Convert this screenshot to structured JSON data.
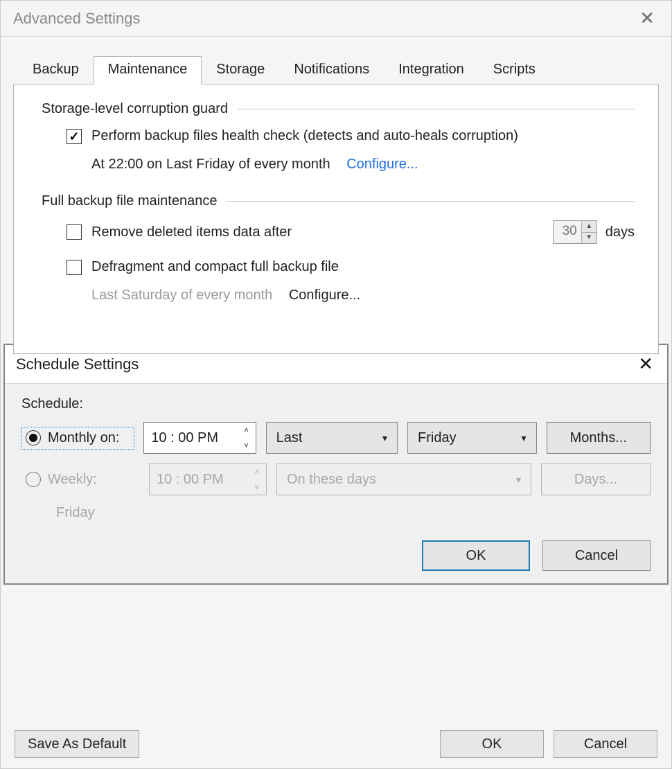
{
  "window": {
    "title": "Advanced Settings",
    "close_icon": "✕"
  },
  "tabs": {
    "backup": "Backup",
    "maintenance": "Maintenance",
    "storage": "Storage",
    "notifications": "Notifications",
    "integration": "Integration",
    "scripts": "Scripts"
  },
  "groups": {
    "corruption_guard": {
      "title": "Storage-level corruption guard",
      "health_check_label": "Perform backup files health check (detects and auto-heals corruption)",
      "health_check_checked": true,
      "schedule_text": "At 22:00 on Last Friday of every month",
      "configure": "Configure..."
    },
    "fb_maint": {
      "title": "Full backup file maintenance",
      "remove_label": "Remove deleted items data after",
      "remove_checked": false,
      "remove_days": "30",
      "days_unit": "days",
      "defrag_label": "Defragment and compact full backup file",
      "defrag_checked": false,
      "defrag_schedule_text": "Last Saturday of every month",
      "defrag_configure": "Configure..."
    }
  },
  "footer": {
    "save_default": "Save As Default",
    "ok": "OK",
    "cancel": "Cancel"
  },
  "dialog": {
    "title": "Schedule Settings",
    "close_icon": "✕",
    "schedule_label": "Schedule:",
    "monthly": {
      "radio_label": "Monthly on:",
      "time": "10 : 00 PM",
      "ordinal": "Last",
      "day": "Friday",
      "months_btn": "Months..."
    },
    "weekly": {
      "radio_label": "Weekly:",
      "time": "10 : 00 PM",
      "days_placeholder": "On these days",
      "days_btn": "Days...",
      "selected_days": "Friday"
    },
    "ok": "OK",
    "cancel": "Cancel"
  }
}
